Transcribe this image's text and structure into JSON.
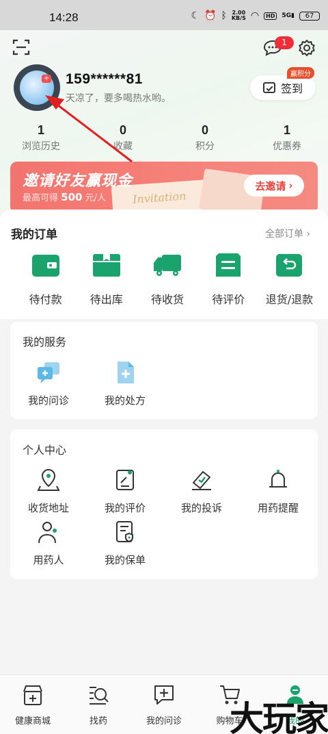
{
  "status_bar": {
    "time": "14:28",
    "net_speed_value": "2.00",
    "net_speed_unit": "KB/S",
    "hd_label": "HD",
    "signal_label": "5G",
    "battery": "67"
  },
  "header": {
    "message_badge": "1",
    "phone": "159******81",
    "slogan": "天凉了，要多喝热水哟。",
    "signin_label": "签到",
    "signin_badge": "赢积分"
  },
  "stats": [
    {
      "value": "1",
      "label": "浏览历史"
    },
    {
      "value": "0",
      "label": "收藏"
    },
    {
      "value": "0",
      "label": "积分"
    },
    {
      "value": "1",
      "label": "优惠券"
    }
  ],
  "banner": {
    "title": "邀请好友赢现金",
    "sub_prefix": "最高可得",
    "sub_amount": "500",
    "sub_suffix": "元/人",
    "ticket_text": "Invitation",
    "button": "去邀请"
  },
  "orders": {
    "title": "我的订单",
    "all_orders": "全部订单",
    "items": [
      {
        "label": "待付款"
      },
      {
        "label": "待出库"
      },
      {
        "label": "待收货"
      },
      {
        "label": "待评价"
      },
      {
        "label": "退货/退款"
      }
    ]
  },
  "services": {
    "title": "我的服务",
    "items": [
      {
        "label": "我的问诊"
      },
      {
        "label": "我的处方"
      }
    ]
  },
  "personal": {
    "title": "个人中心",
    "items": [
      {
        "label": "收货地址"
      },
      {
        "label": "我的评价"
      },
      {
        "label": "我的投诉"
      },
      {
        "label": "用药提醒"
      },
      {
        "label": "用药人"
      },
      {
        "label": "我的保单"
      }
    ]
  },
  "bottom_nav": [
    {
      "label": "健康商城"
    },
    {
      "label": "找药"
    },
    {
      "label": "我的问诊"
    },
    {
      "label": "购物车"
    },
    {
      "label": "我的"
    }
  ],
  "watermark": "大玩家",
  "colors": {
    "accent": "#1aa36c",
    "badge": "#f02e3a",
    "banner": "#f3746e",
    "annotation_arrow": "#e02020"
  }
}
